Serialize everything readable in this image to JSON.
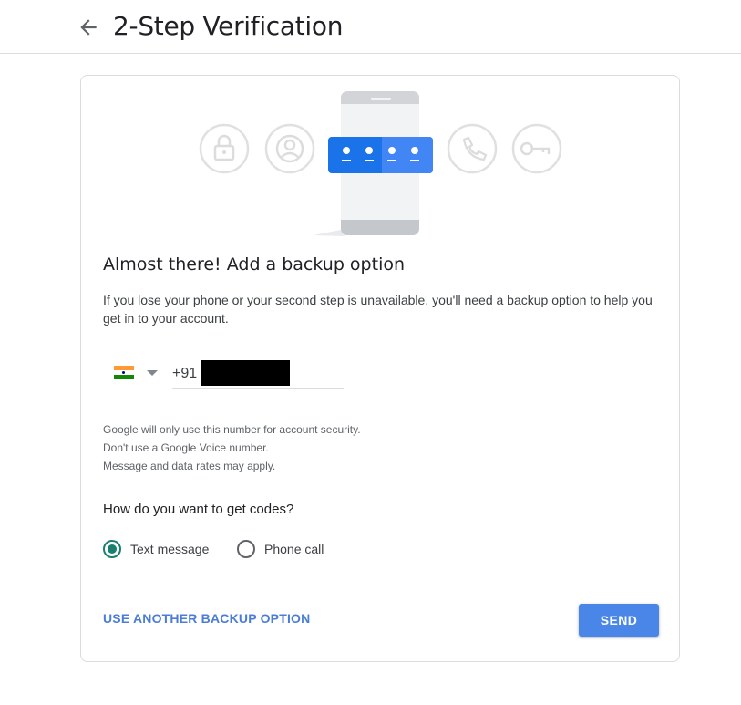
{
  "header": {
    "title": "2-Step Verification",
    "back_icon": "arrow-left-icon"
  },
  "card": {
    "illustration_icons": [
      "lock-icon",
      "account-circle-icon",
      "password-dots-icon",
      "phone-call-icon",
      "key-icon"
    ],
    "heading": "Almost there! Add a backup option",
    "description": "If you lose your phone or your second step is unavailable, you'll need a backup option to help you get in to your account.",
    "phone": {
      "country_flag": "india-flag-icon",
      "country_code": "+91",
      "number_redacted": true
    },
    "notes": [
      "Google will only use this number for account security.",
      "Don't use a Google Voice number.",
      "Message and data rates may apply."
    ],
    "question": "How do you want to get codes?",
    "options": [
      {
        "label": "Text message",
        "selected": true
      },
      {
        "label": "Phone call",
        "selected": false
      }
    ],
    "alt_link": "USE ANOTHER BACKUP OPTION",
    "send_label": "SEND",
    "colors": {
      "accent": "#1a7f6e",
      "button": "#4a86e8",
      "link": "#4b7dd6"
    }
  }
}
